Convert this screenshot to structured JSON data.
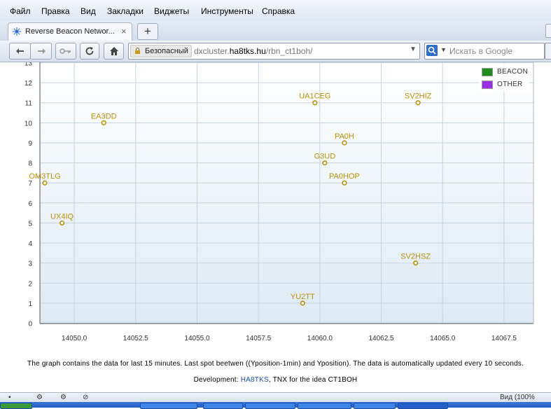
{
  "menu": [
    "Файл",
    "Правка",
    "Вид",
    "Закладки",
    "Виджеты",
    "Инструменты",
    "Справка"
  ],
  "tab": {
    "title": "Reverse Beacon Networ...",
    "close": "×",
    "new_tab": "+"
  },
  "nav": {
    "identity": "Безопасный",
    "url_prefix": "dxcluster.",
    "url_domain": "ha8tks.hu",
    "url_path": "/rbn_ct1boh/",
    "search_placeholder": "Искать в Google"
  },
  "chart_data": {
    "type": "scatter",
    "xlim": [
      14048.6,
      14068.7
    ],
    "ylim": [
      0,
      13
    ],
    "x_ticks": [
      14050.0,
      14052.5,
      14055.0,
      14057.5,
      14060.0,
      14062.5,
      14065.0,
      14067.5
    ],
    "x_tick_labels": [
      "14050.0",
      "14052.5",
      "14055.0",
      "14057.5",
      "14060.0",
      "14062.5",
      "14065.0",
      "14067.5"
    ],
    "y_ticks": [
      0,
      1,
      2,
      3,
      4,
      5,
      6,
      7,
      8,
      9,
      10,
      11,
      12,
      13
    ],
    "grid": true,
    "legend_position": "top-right",
    "legend": [
      {
        "name": "BEACON",
        "color": "#1f8c1f"
      },
      {
        "name": "OTHER",
        "color": "#9b30e8"
      }
    ],
    "point_color": "#b8900a",
    "points": [
      {
        "label": "OM3TLG",
        "x": 14048.8,
        "y": 7
      },
      {
        "label": "UX4IQ",
        "x": 14049.5,
        "y": 5
      },
      {
        "label": "EA3DD",
        "x": 14051.2,
        "y": 10
      },
      {
        "label": "UA1CEG",
        "x": 14059.8,
        "y": 11
      },
      {
        "label": "SV2HIZ",
        "x": 14064.0,
        "y": 11
      },
      {
        "label": "PA0H",
        "x": 14061.0,
        "y": 9
      },
      {
        "label": "G3UD",
        "x": 14060.2,
        "y": 8
      },
      {
        "label": "PA0HOP",
        "x": 14061.0,
        "y": 7
      },
      {
        "label": "SV2HSZ",
        "x": 14063.9,
        "y": 3
      },
      {
        "label": "YU2TT",
        "x": 14059.3,
        "y": 1
      }
    ]
  },
  "footer": {
    "note": "The graph contains the data for last 15 minutes. Last spot beetwen ((Yposition-1min) and Yposition). The data is automatically updated every 10 seconds.",
    "dev_prefix": "Development: ",
    "dev_link": "HA8TKS",
    "dev_suffix": ", TNX for the idea CT1BOH"
  },
  "status": {
    "zoom": "Вид (100%"
  }
}
